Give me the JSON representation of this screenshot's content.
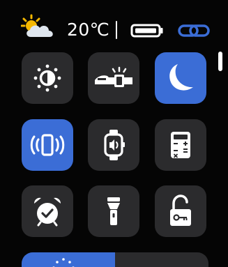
{
  "status": {
    "temperature": "20℃",
    "weather_icon": "partly-cloudy-icon",
    "battery_icon": "battery-icon",
    "connection_icon": "link-icon"
  },
  "tiles": [
    {
      "icon": "brightness-icon",
      "active": false
    },
    {
      "icon": "raise-to-wake-icon",
      "active": false
    },
    {
      "icon": "moon-icon",
      "active": true
    },
    {
      "icon": "vibration-icon",
      "active": true
    },
    {
      "icon": "find-watch-icon",
      "active": false
    },
    {
      "icon": "calculator-icon",
      "active": false
    },
    {
      "icon": "alarm-icon",
      "active": false
    },
    {
      "icon": "flashlight-icon",
      "active": false
    },
    {
      "icon": "unlock-icon",
      "active": false
    }
  ],
  "brightness_slider": {
    "icon": "sun-icon",
    "level": 0.5
  },
  "colors": {
    "accent": "#3b6dd6",
    "tile": "#2b2b2d",
    "background": "#050505",
    "link": "#3b6dd6"
  }
}
